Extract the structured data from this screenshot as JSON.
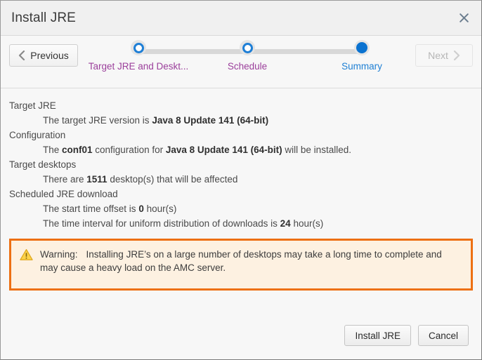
{
  "window": {
    "title": "Install JRE",
    "close_icon": "close-icon"
  },
  "wizard": {
    "previous_label": "Previous",
    "next_label": "Next",
    "steps": [
      {
        "label": "Target JRE and Deskt...",
        "state": "done"
      },
      {
        "label": "Schedule",
        "state": "done"
      },
      {
        "label": "Summary",
        "state": "active"
      }
    ],
    "colors": {
      "done_label": "#9b3f9b",
      "active_label": "#1e7fd4",
      "dot_blue": "#0a72d0",
      "track": "#d8d8d8"
    }
  },
  "summary": {
    "groups": [
      {
        "title": "Target JRE",
        "details": [
          {
            "pre": "The target JRE version is ",
            "strong": "Java 8 Update 141 (64-bit)",
            "post": ""
          }
        ]
      },
      {
        "title": "Configuration",
        "details": [
          {
            "pre": "The ",
            "strong": "conf01",
            "post": " configuration for ",
            "strong2": "Java 8 Update 141 (64-bit)",
            "post2": " will be installed."
          }
        ]
      },
      {
        "title": "Target desktops",
        "details": [
          {
            "pre": "There are ",
            "strong": "1511",
            "post": " desktop(s) that will be affected"
          }
        ]
      },
      {
        "title": "Scheduled JRE download",
        "details": [
          {
            "pre": "The start time offset is ",
            "strong": "0",
            "post": " hour(s)"
          },
          {
            "pre": "The time interval for uniform distribution of downloads is ",
            "strong": "24",
            "post": " hour(s)"
          }
        ]
      }
    ]
  },
  "warning": {
    "icon": "warning-triangle-icon",
    "label": "Warning:",
    "text": "Installing JRE’s on a large number of desktops may take a long time to complete and may cause a heavy load on the AMC server.",
    "border_color": "#ed7014",
    "background_color": "#fdf1e1"
  },
  "footer": {
    "primary_label": "Install JRE",
    "secondary_label": "Cancel"
  }
}
